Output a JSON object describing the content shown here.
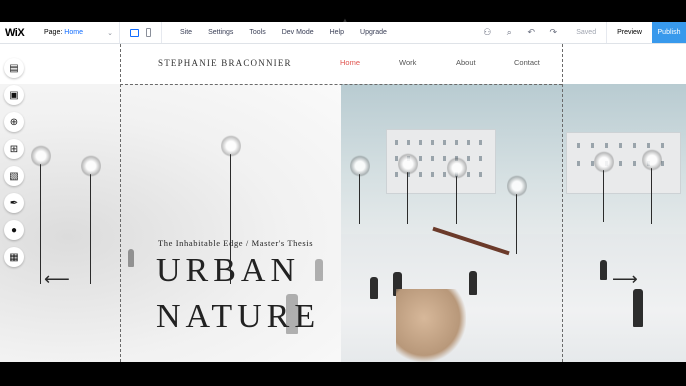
{
  "editor": {
    "logo": "WiX",
    "page_label": "Page:",
    "page_value": "Home",
    "menu": [
      "Site",
      "Settings",
      "Tools",
      "Dev Mode",
      "Help",
      "Upgrade"
    ],
    "status": "Saved",
    "preview": "Preview",
    "publish": "Publish"
  },
  "site": {
    "brand": "STEPHANIE BRACONNIER",
    "nav": [
      "Home",
      "Work",
      "About",
      "Contact"
    ],
    "active_nav": "Home",
    "kicker": "The Inhabitable Edge / Master's Thesis",
    "headline_line1": "URBAN",
    "headline_line2": "NATURE",
    "prev_arrow": "⟵",
    "next_arrow": "⟶"
  },
  "rail_icons": [
    "menus-pages-icon",
    "background-icon",
    "add-icon",
    "add-apps-icon",
    "media-icon",
    "pen-icon",
    "chat-icon",
    "app-market-icon"
  ],
  "colors": {
    "accent": "#116dff",
    "publish_bg": "#3899ec",
    "active_nav": "#e0554f"
  }
}
